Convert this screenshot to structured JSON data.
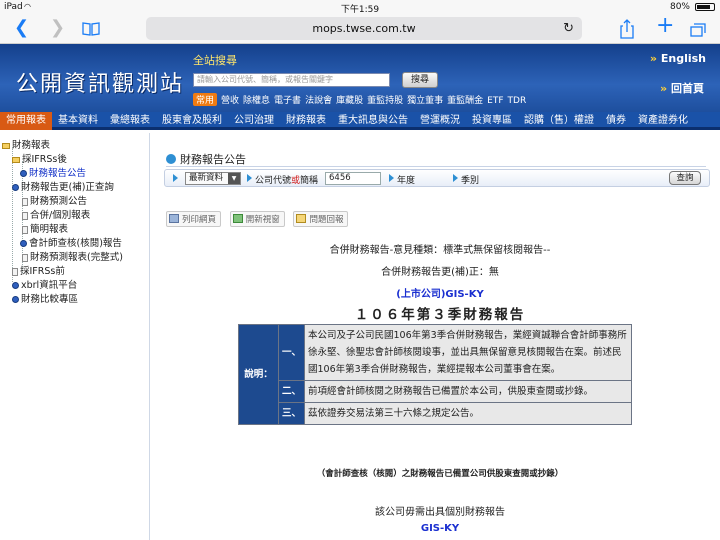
{
  "status_bar": {
    "device": "iPad",
    "time": "下午1:59",
    "battery": "80%",
    "battery_level": 0.8
  },
  "browser": {
    "url": "mops.twse.com.tw"
  },
  "site": {
    "logo": "公開資訊觀測站",
    "search_title": "全站搜尋",
    "search_placeholder": "請輸入公司代號、簡稱，或報告關鍵字",
    "search_button": "搜尋",
    "quick_tag": "常用",
    "quick_links": [
      "營收",
      "除權息",
      "電子書",
      "法說會",
      "庫藏股",
      "董監持股",
      "獨立董事",
      "董監酬金",
      "ETF",
      "TDR"
    ],
    "english_link": "English",
    "home_link": "回首頁"
  },
  "nav": {
    "active_index": 0,
    "items": [
      "常用報表",
      "基本資料",
      "彙總報表",
      "股東會及股利",
      "公司治理",
      "財務報表",
      "重大訊息與公告",
      "營運概況",
      "投資專區",
      "認購（售）權證",
      "債券",
      "資產證券化"
    ]
  },
  "sidebar": {
    "items": [
      {
        "label": "財務報表",
        "icon": "folder-icon"
      },
      {
        "label": "採IFRSs後",
        "icon": "folder-icon"
      },
      {
        "label": "財務報告公告",
        "icon": "dot-icon",
        "selected": true
      },
      {
        "label": "財務報告更(補)正查詢",
        "icon": "dot-icon"
      },
      {
        "label": "財務預測公告",
        "icon": "doc-icon"
      },
      {
        "label": "合併/個別報表",
        "icon": "doc-icon"
      },
      {
        "label": "簡明報表",
        "icon": "doc-icon"
      },
      {
        "label": "會計師查核(核閱)報告",
        "icon": "dot-icon"
      },
      {
        "label": "財務預測報表(完整式)",
        "icon": "doc-icon"
      },
      {
        "label": "採IFRSs前",
        "icon": "doc-icon"
      },
      {
        "label": "xbrl資訊平台",
        "icon": "dot-icon"
      },
      {
        "label": "財務比較專區",
        "icon": "dot-icon"
      }
    ]
  },
  "main": {
    "section_title": "財務報告公告",
    "query": {
      "select_value": "最新資料",
      "code_label_pre": "公司代號",
      "code_label_em": "或",
      "code_label_post": "簡稱",
      "code_value": "6456",
      "year_label": "年度",
      "season_label": "季別",
      "query_button": "查詢"
    },
    "tools": [
      "列印網頁",
      "開新視窗",
      "問題回報"
    ],
    "opinion_line": "合併財務報告-意見種類：標準式無保留核閱報告--",
    "correction_line": "合併財務報告更(補)正：無",
    "company": "(上市公司)GIS-KY",
    "report_title": "１０６年第３季財務報告",
    "desc_head": "說明：",
    "desc_rows": [
      {
        "num": "一、",
        "text": "本公司及子公司民國106年第3季合併財務報告，業經資誠聯合會計師事務所徐永堅、徐聖忠會計師核閱竣事，並出具無保留意見核閱報告在案。前述民國106年第3季合併財務報告，業經提報本公司董事會在案。"
      },
      {
        "num": "二、",
        "text": "前項經會計師核閱之財務報告已備置於本公司，供股東查閱或抄錄。"
      },
      {
        "num": "三、",
        "text": "茲依證券交易法第三十六條之規定公告。"
      }
    ],
    "note": "（會計師查核（核閱）之財務報告已備置公司供股東查閱或抄錄）",
    "individual_line": "該公司毋需出具個別財務報告",
    "company2": "GIS-KY"
  }
}
